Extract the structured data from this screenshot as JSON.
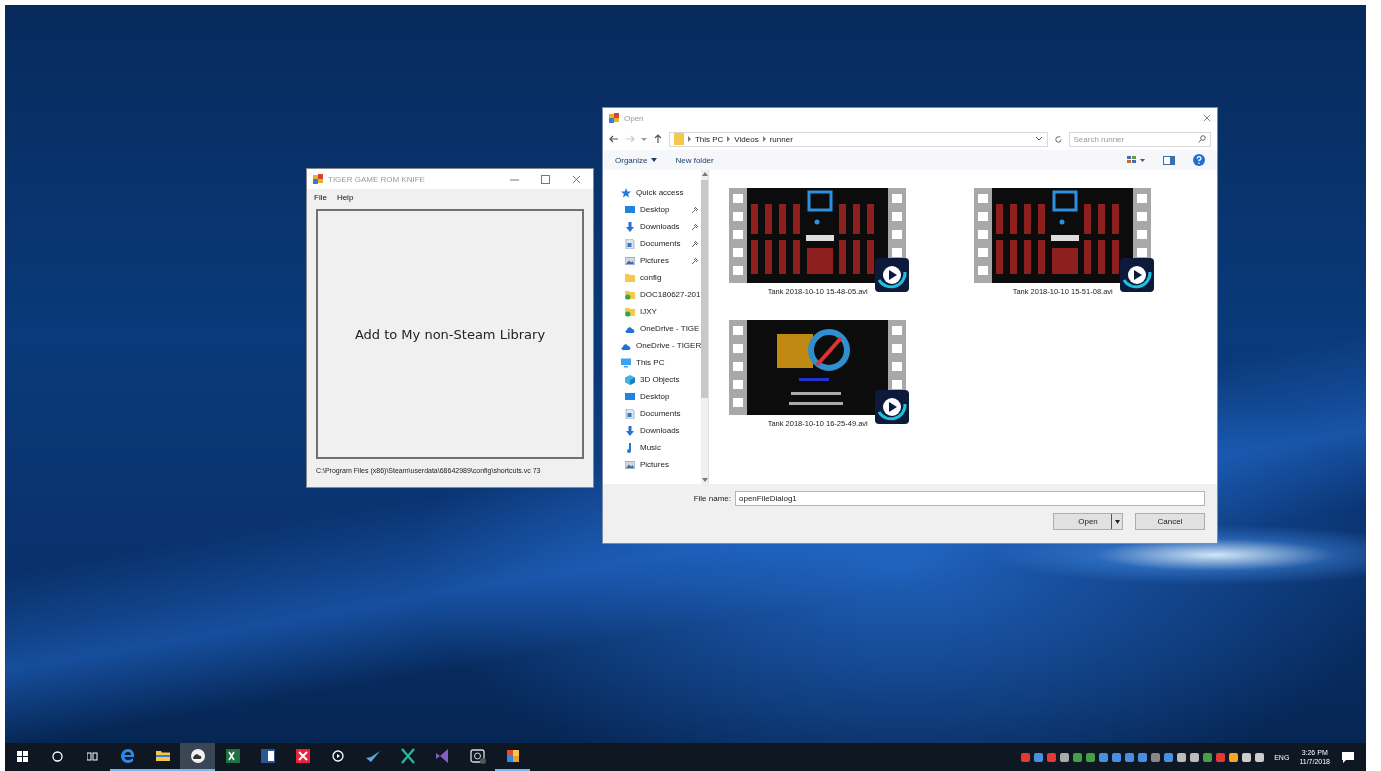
{
  "app_window": {
    "title": "TIGER GAME ROM KNIFE",
    "menu": [
      "File",
      "Help"
    ],
    "button": "Add to My non-Steam Library",
    "status": "C:\\Program Files (x86)\\Steam\\userdata\\68642989\\config\\shortcuts.vc 73"
  },
  "open_dialog": {
    "title": "Open",
    "breadcrumb": [
      "This PC",
      "Videos",
      "runner"
    ],
    "search": {
      "placeholder": "Search runner"
    },
    "toolbar": [
      "Organize",
      "New folder"
    ],
    "nav": [
      {
        "name": "Quick access",
        "kind": "star",
        "pinned": false,
        "children": [
          {
            "name": "Desktop",
            "kind": "monitor",
            "pinned": true
          },
          {
            "name": "Downloads",
            "kind": "download",
            "pinned": true
          },
          {
            "name": "Documents",
            "kind": "document",
            "pinned": true
          },
          {
            "name": "Pictures",
            "pinned": true
          },
          {
            "name": "config",
            "kind": "folder",
            "pinned": false
          },
          {
            "name": "DOC180627-201",
            "kind": "synced-folder",
            "pinned": false
          },
          {
            "name": "IJXY",
            "kind": "synced-folder",
            "pinned": false
          },
          {
            "name": "OneDrive - TIGE",
            "kind": "cloud",
            "pinned": false
          }
        ]
      },
      {
        "name": "OneDrive - TIGER",
        "kind": "cloud",
        "pinned": false
      },
      {
        "name": "This PC",
        "kind": "computer",
        "pinned": false,
        "children": [
          {
            "name": "3D Objects",
            "kind": "cube",
            "pinned": false
          },
          {
            "name": "Desktop",
            "kind": "monitor",
            "pinned": false
          },
          {
            "name": "Documents",
            "kind": "document",
            "pinned": false
          },
          {
            "name": "Downloads",
            "kind": "download",
            "pinned": false
          },
          {
            "name": "Music",
            "kind": "music",
            "pinned": false
          },
          {
            "name": "Pictures",
            "pinned": false
          }
        ]
      }
    ],
    "files": [
      {
        "name": "Tank 2018-10-10 15-48-05.avi",
        "kind": "picture"
      },
      {
        "name": "Tank 2018-10-10 15-51-08.avi",
        "kind": "picture"
      },
      {
        "name": "Tank 2018-10-10 16-25-49.avi",
        "kind": "picture"
      }
    ],
    "file_name": {
      "label": "File name:",
      "value": "openFileDialog1"
    },
    "buttons": [
      "Open",
      "Cancel"
    ]
  },
  "taskbar": {
    "apps": [
      {
        "kind": "edge",
        "running": true,
        "active": false
      },
      {
        "kind": "folder",
        "running": true,
        "active": false
      },
      {
        "kind": "cloud",
        "running": true,
        "active": true
      },
      {
        "kind": "excel",
        "running": false,
        "active": false
      },
      {
        "kind": "word",
        "running": false,
        "active": false
      },
      {
        "kind": "cross",
        "running": false,
        "active": false
      },
      {
        "kind": "play",
        "running": false,
        "active": false
      },
      {
        "kind": "check",
        "running": false,
        "active": false
      },
      {
        "kind": "xlogo",
        "running": false,
        "active": false
      },
      {
        "kind": "vs",
        "running": false,
        "active": false
      },
      {
        "kind": "camera",
        "running": false,
        "active": false
      },
      {
        "kind": "palette",
        "running": true,
        "active": false
      }
    ],
    "language": "ENG",
    "time": "3:26 PM",
    "date": "11/7/2018"
  }
}
